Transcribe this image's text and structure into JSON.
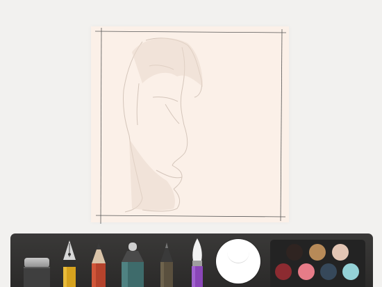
{
  "canvas": {
    "paper_color": "#fbf0e8"
  },
  "toolbar": {
    "tools": [
      "eraser",
      "fountain-pen",
      "pencil",
      "marker",
      "outline-pen",
      "watercolor-brush"
    ],
    "color_mixer": "color-mixer"
  },
  "palette": {
    "colors": [
      "#2f2421",
      "#b78a58",
      "#e2c5b4",
      "#8c2b31",
      "#e77c88",
      "#36485a",
      "#94d1d6"
    ]
  }
}
